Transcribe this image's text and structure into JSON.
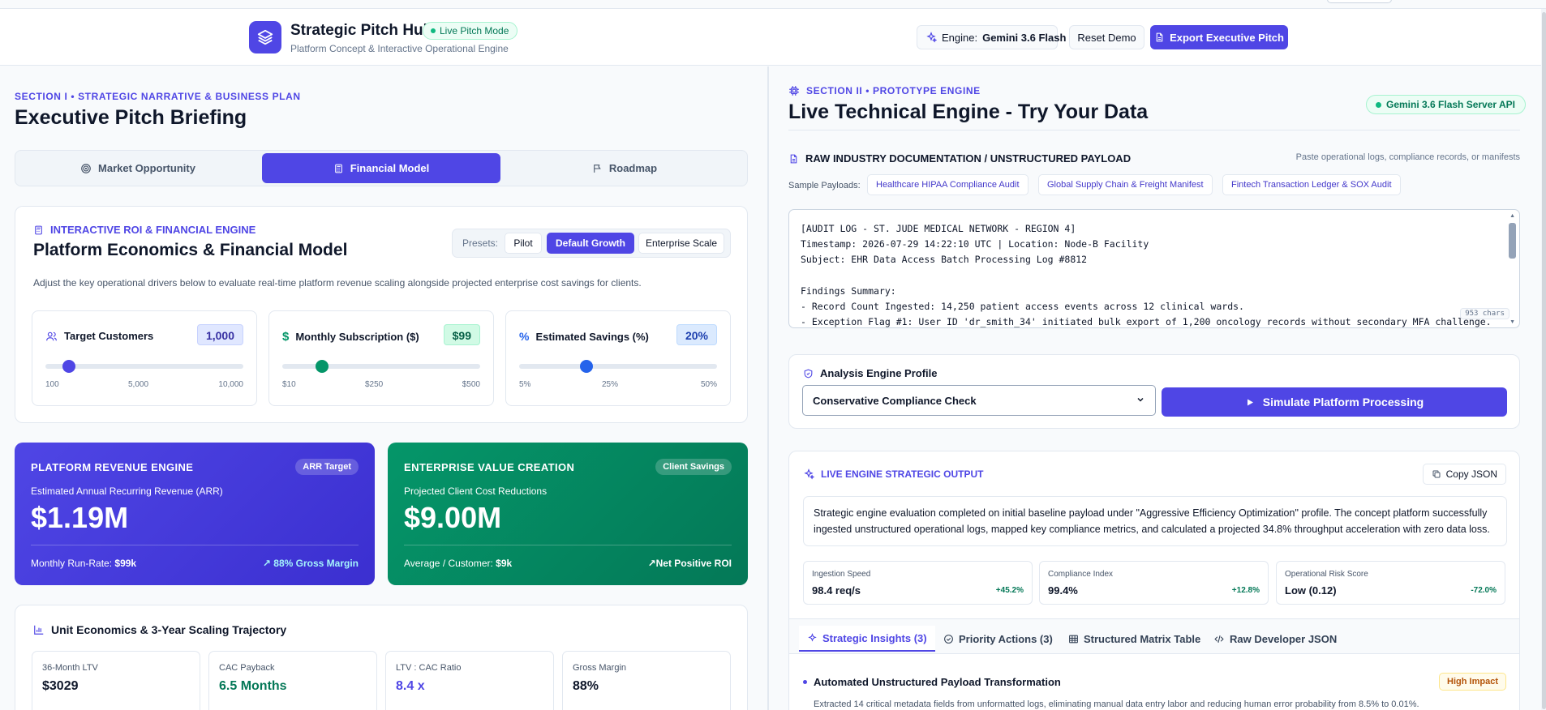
{
  "header": {
    "title": "Strategic Pitch Hub",
    "badge": "Live Pitch Mode",
    "subtitle": "Platform Concept & Interactive Operational Engine",
    "engine_prefix": "Engine:",
    "engine_name": "Gemini 3.6 Flash",
    "reset_label": "Reset Demo",
    "export_label": "Export Executive Pitch"
  },
  "left": {
    "kicker": "Section I • Strategic Narrative & Business Plan",
    "title": "Executive Pitch Briefing",
    "tabs": [
      {
        "label": "Market Opportunity",
        "icon": "target-icon"
      },
      {
        "label": "Financial Model",
        "icon": "calculator-icon"
      },
      {
        "label": "Roadmap",
        "icon": "flag-icon"
      }
    ],
    "roi": {
      "kicker": "Interactive ROI & Financial Engine",
      "title": "Platform Economics & Financial Model",
      "presets_label": "Presets:",
      "presets": [
        "Pilot",
        "Default Growth",
        "Enterprise Scale"
      ],
      "description": "Adjust the key operational drivers below to evaluate real-time platform revenue scaling alongside projected enterprise cost savings for clients.",
      "sliders": [
        {
          "label": "Target Customers",
          "value": "1,000",
          "ticks": [
            "100",
            "5,000",
            "10,000"
          ],
          "position": 0.12,
          "color": "#4f46e5"
        },
        {
          "label": "Monthly Subscription ($)",
          "value": "$99",
          "ticks": [
            "$10",
            "$250",
            "$500"
          ],
          "position": 0.2,
          "color": "#059669"
        },
        {
          "label": "Estimated Savings (%)",
          "value": "20%",
          "ticks": [
            "5%",
            "25%",
            "50%"
          ],
          "position": 0.34,
          "color": "#2563eb"
        }
      ]
    },
    "revenue": {
      "kicker": "Platform Revenue Engine",
      "badge": "ARR Target",
      "sub": "Estimated Annual Recurring Revenue (ARR)",
      "value": "$1.19M",
      "foot_label": "Monthly Run-Rate:",
      "foot_value": "$99k",
      "foot_right": "88% Gross Margin"
    },
    "value_creation": {
      "kicker": "Enterprise Value Creation",
      "badge": "Client Savings",
      "sub": "Projected Client Cost Reductions",
      "value": "$9.00M",
      "foot_label": "Average / Customer:",
      "foot_value": "$9k",
      "foot_right": "Net Positive ROI"
    },
    "unit": {
      "title": "Unit Economics & 3-Year Scaling Trajectory",
      "metrics": [
        {
          "label": "36-Month LTV",
          "value": "$3029",
          "color": "#0f172a"
        },
        {
          "label": "CAC Payback",
          "value": "6.5 Months",
          "color": "#047857"
        },
        {
          "label": "LTV : CAC Ratio",
          "value": "8.4 x",
          "color": "#4f46e5"
        },
        {
          "label": "Gross Margin",
          "value": "88%",
          "color": "#0f172a"
        }
      ]
    }
  },
  "right": {
    "kicker": "Section II • Prototype Engine",
    "title": "Live Technical Engine - Try Your Data",
    "api_badge": "Gemini 3.6 Flash Server API",
    "raw_title": "Raw Industry Documentation / Unstructured Payload",
    "raw_hint": "Paste operational logs, compliance records, or manifests",
    "samples_label": "Sample Payloads:",
    "samples": [
      "Healthcare HIPAA Compliance Audit",
      "Global Supply Chain & Freight Manifest",
      "Fintech Transaction Ledger & SOX Audit"
    ],
    "payload_lines": [
      "[AUDIT LOG - ST. JUDE MEDICAL NETWORK - REGION 4]",
      "Timestamp: 2026-07-29 14:22:10 UTC | Location: Node-B Facility",
      "Subject: EHR Data Access Batch Processing Log #8812",
      "",
      "Findings Summary:",
      "- Record Count Ingested: 14,250 patient access events across 12 clinical wards.",
      "- Exception Flag #1: User ID 'dr_smith_34' initiated bulk export of 1,200 oncology records without secondary MFA challenge."
    ],
    "char_count": "953 chars",
    "profile_label": "Analysis Engine Profile",
    "profile_value": "Conservative Compliance Check",
    "simulate_label": "Simulate Platform Processing",
    "output": {
      "kicker": "Live Engine Strategic Output",
      "copy_label": "Copy JSON",
      "summary": "Strategic engine evaluation completed on initial baseline payload under \"Aggressive Efficiency Optimization\" profile. The concept platform successfully ingested unstructured operational logs, mapped key compliance metrics, and calculated a projected 34.8% throughput acceleration with zero data loss.",
      "kpis": [
        {
          "label": "Ingestion Speed",
          "value": "98.4 req/s",
          "delta": "+45.2%",
          "color": "#047857"
        },
        {
          "label": "Compliance Index",
          "value": "99.4%",
          "delta": "+12.8%",
          "color": "#047857"
        },
        {
          "label": "Operational Risk Score",
          "value": "Low (0.12)",
          "delta": "-72.0%",
          "color": "#047857"
        }
      ],
      "tabs": [
        "Strategic Insights (3)",
        "Priority Actions (3)",
        "Structured Matrix Table",
        "Raw Developer JSON"
      ],
      "insight_title": "Automated Unstructured Payload Transformation",
      "insight_impact": "High Impact",
      "insight_body": "Extracted 14 critical metadata fields from unformatted logs, eliminating manual data entry labor and reducing human error probability from 8.5% to 0.01%."
    }
  }
}
